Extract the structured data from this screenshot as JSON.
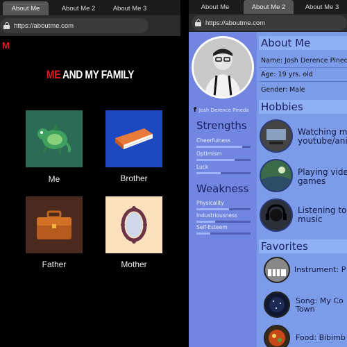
{
  "left": {
    "tabs": [
      {
        "label": "About Me",
        "active": true
      },
      {
        "label": "About Me 2",
        "active": false
      },
      {
        "label": "About Me 3",
        "active": false
      }
    ],
    "url": "https://aboutme.com",
    "logo": "M",
    "title_red": "ME",
    "title_white": "AND MY FAMILY",
    "cards": [
      {
        "label": "Me",
        "icon": "dragon-icon",
        "bg": "#2c6b55"
      },
      {
        "label": "Brother",
        "icon": "book-icon",
        "bg": "#1d49c0"
      },
      {
        "label": "Father",
        "icon": "briefcase-icon",
        "bg": "#4a2a1f"
      },
      {
        "label": "Mother",
        "icon": "mirror-icon",
        "bg": "#fbe2bd"
      }
    ]
  },
  "right": {
    "tabs": [
      {
        "label": "About Me",
        "active": false
      },
      {
        "label": "About Me 2",
        "active": true
      },
      {
        "label": "About Me 3",
        "active": false
      }
    ],
    "url": "https://aboutme.com",
    "facebook_name": "Josh Derence Pineda",
    "strengths_title": "Strengths",
    "strengths": [
      {
        "label": "Cheerfulness",
        "level": 0.85
      },
      {
        "label": "Optimism",
        "level": 0.7
      },
      {
        "label": "Luck",
        "level": 0.45
      }
    ],
    "weakness_title": "Weakness",
    "weaknesses": [
      {
        "label": "Physicality",
        "level": 0.6
      },
      {
        "label": "Industriousness",
        "level": 0.35
      },
      {
        "label": "Self-Esteem",
        "level": 0.25
      }
    ],
    "about_title": "About Me",
    "about_lines": [
      "Name: Josh Derence Pineda",
      "Age: 19 yrs. old",
      "Gender: Male"
    ],
    "hobbies_title": "Hobbies",
    "hobbies": [
      {
        "line1": "Watching m",
        "line2": "youtube/ani"
      },
      {
        "line1": "Playing vide",
        "line2": "games"
      },
      {
        "line1": "Listening to",
        "line2": "music"
      }
    ],
    "favorites_title": "Favorites",
    "favorites": [
      {
        "line1": "Instrument: P",
        "line2": ""
      },
      {
        "line1": "Song: My Co",
        "line2": "Town"
      },
      {
        "line1": "Food: Bibimb",
        "line2": ""
      }
    ]
  }
}
